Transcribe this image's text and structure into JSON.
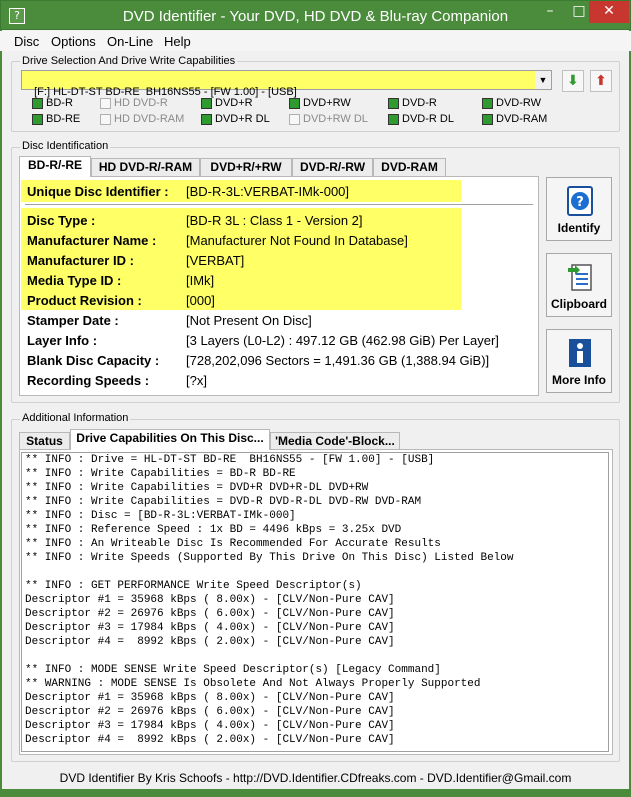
{
  "window": {
    "title": "DVD Identifier - Your DVD, HD DVD & Blu-ray Companion",
    "app_icon": "?",
    "minimize": "–",
    "maximize": "□",
    "close": "✕"
  },
  "menu": [
    "Disc",
    "Options",
    "On-Line",
    "Help"
  ],
  "drive_group": {
    "label": "Drive Selection And Drive Write Capabilities",
    "selected_drive": "[F:] HL-DT-ST BD-RE  BH16NS55 - [FW 1.00] - [USB]",
    "capabilities": [
      {
        "label": "BD-R",
        "checked": true,
        "enabled": true
      },
      {
        "label": "HD DVD-R",
        "checked": false,
        "enabled": false
      },
      {
        "label": "DVD+R",
        "checked": true,
        "enabled": true
      },
      {
        "label": "DVD+RW",
        "checked": true,
        "enabled": true
      },
      {
        "label": "DVD-R",
        "checked": true,
        "enabled": true
      },
      {
        "label": "DVD-RW",
        "checked": true,
        "enabled": true
      },
      {
        "label": "BD-RE",
        "checked": true,
        "enabled": true
      },
      {
        "label": "HD DVD-RAM",
        "checked": false,
        "enabled": false
      },
      {
        "label": "DVD+R DL",
        "checked": true,
        "enabled": true
      },
      {
        "label": "DVD+RW DL",
        "checked": false,
        "enabled": false
      },
      {
        "label": "DVD-R DL",
        "checked": true,
        "enabled": true
      },
      {
        "label": "DVD-RAM",
        "checked": true,
        "enabled": true
      }
    ]
  },
  "disc_group": {
    "label": "Disc Identification",
    "tabs": [
      "BD-R/-RE",
      "HD DVD-R/-RAM",
      "DVD+R/+RW",
      "DVD-R/-RW",
      "DVD-RAM"
    ],
    "fields": [
      {
        "label": "Unique Disc Identifier :",
        "value": "[BD-R-3L:VERBAT-IMk-000]"
      },
      {
        "label": "Disc Type :",
        "value": "[BD-R 3L : Class 1 - Version 2]"
      },
      {
        "label": "Manufacturer Name :",
        "value": "[Manufacturer Not Found In Database]"
      },
      {
        "label": "Manufacturer ID :",
        "value": "[VERBAT]"
      },
      {
        "label": "Media Type ID :",
        "value": "[IMk]"
      },
      {
        "label": "Product Revision :",
        "value": "[000]"
      },
      {
        "label": "Stamper Date :",
        "value": "[Not Present On Disc]"
      },
      {
        "label": "Layer Info :",
        "value": "[3 Layers (L0-L2) : 497.12 GB (462.98 GiB) Per Layer]"
      },
      {
        "label": "Blank Disc Capacity :",
        "value": "[728,202,096 Sectors = 1,491.36 GB (1,388.94 GiB)]"
      },
      {
        "label": "Recording Speeds :",
        "value": "[?x]"
      }
    ],
    "buttons": [
      "Identify",
      "Clipboard",
      "More Info"
    ]
  },
  "info_group": {
    "label": "Additional Information",
    "tabs": [
      "Status",
      "Drive Capabilities On This Disc...",
      "'Media Code'-Block..."
    ],
    "log": [
      "** INFO : Drive = HL-DT-ST BD-RE  BH16NS55 - [FW 1.00] - [USB]",
      "** INFO : Write Capabilities = BD-R BD-RE",
      "** INFO : Write Capabilities = DVD+R DVD+R-DL DVD+RW",
      "** INFO : Write Capabilities = DVD-R DVD-R-DL DVD-RW DVD-RAM",
      "** INFO : Disc = [BD-R-3L:VERBAT-IMk-000]",
      "** INFO : Reference Speed : 1x BD = 4496 kBps = 3.25x DVD",
      "** INFO : An Writeable Disc Is Recommended For Accurate Results",
      "** INFO : Write Speeds (Supported By This Drive On This Disc) Listed Below",
      "",
      "** INFO : GET PERFORMANCE Write Speed Descriptor(s)",
      "Descriptor #1 = 35968 kBps ( 8.00x) - [CLV/Non-Pure CAV]",
      "Descriptor #2 = 26976 kBps ( 6.00x) - [CLV/Non-Pure CAV]",
      "Descriptor #3 = 17984 kBps ( 4.00x) - [CLV/Non-Pure CAV]",
      "Descriptor #4 =  8992 kBps ( 2.00x) - [CLV/Non-Pure CAV]",
      "",
      "** INFO : MODE SENSE Write Speed Descriptor(s) [Legacy Command]",
      "** WARNING : MODE SENSE Is Obsolete And Not Always Properly Supported",
      "Descriptor #1 = 35968 kBps ( 8.00x) - [CLV/Non-Pure CAV]",
      "Descriptor #2 = 26976 kBps ( 6.00x) - [CLV/Non-Pure CAV]",
      "Descriptor #3 = 17984 kBps ( 4.00x) - [CLV/Non-Pure CAV]",
      "Descriptor #4 =  8992 kBps ( 2.00x) - [CLV/Non-Pure CAV]"
    ]
  },
  "statusbar": "DVD Identifier By Kris Schoofs  -  http://DVD.Identifier.CDfreaks.com  -  DVD.Identifier@Gmail.com",
  "colors": {
    "highlight": "#ffff66",
    "titlebar": "#4a8c3c",
    "close": "#c7372f",
    "check": "#2f9a2f"
  }
}
